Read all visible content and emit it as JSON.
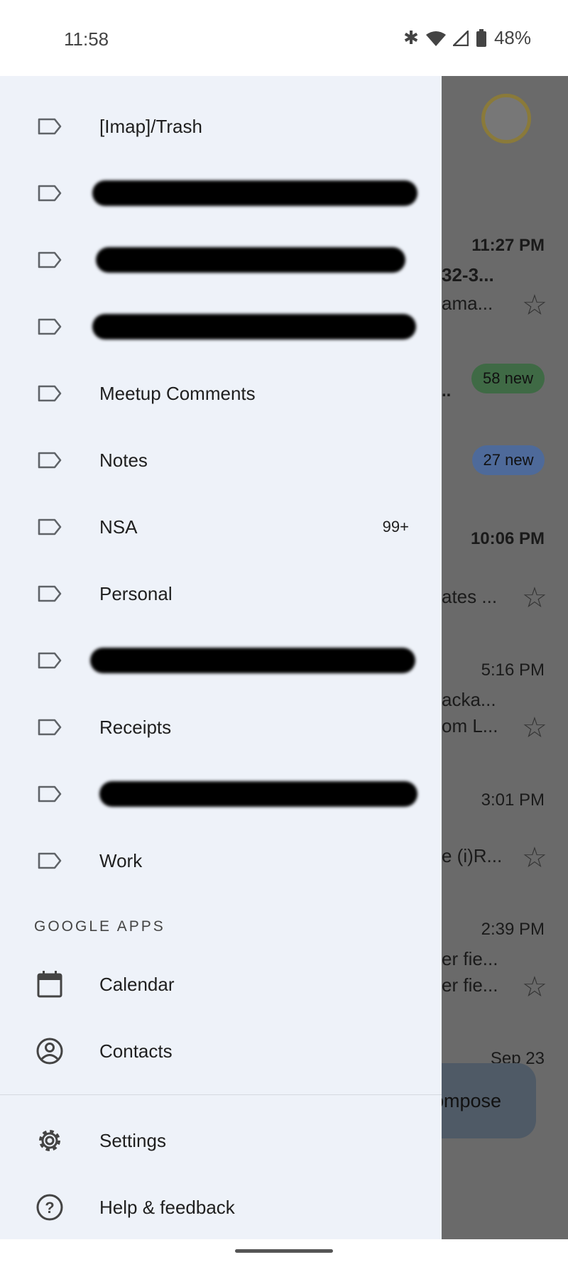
{
  "status_bar": {
    "time": "11:58",
    "battery": "48%",
    "icons": [
      "bluetooth-icon",
      "wifi-icon",
      "signal-icon",
      "battery-icon"
    ]
  },
  "background": {
    "times": [
      "11:27 PM",
      "10:06 PM",
      "5:16 PM",
      "3:01 PM",
      "2:39 PM",
      "Sep 23"
    ],
    "snippets": [
      "32-3...",
      "ama...",
      "..",
      "ates  ...",
      "acka...",
      "om L...",
      "e (i)R...",
      "er fie...",
      "er fie..."
    ],
    "badges": [
      {
        "label": "58 new",
        "color": "#3f6a45"
      },
      {
        "label": "27 new",
        "color": "#4e6a9a"
      }
    ],
    "compose_label": "ompose"
  },
  "drawer": {
    "labels": [
      {
        "label": "[Imap]/Trash",
        "count": ""
      },
      {
        "label": "",
        "redacted": true
      },
      {
        "label": "",
        "redacted": true
      },
      {
        "label": "",
        "redacted": true
      },
      {
        "label": "Meetup Comments",
        "count": ""
      },
      {
        "label": "Notes",
        "count": ""
      },
      {
        "label": "NSA",
        "count": "99+"
      },
      {
        "label": "Personal",
        "count": ""
      },
      {
        "label": "",
        "redacted": true
      },
      {
        "label": "Receipts",
        "count": ""
      },
      {
        "label": "",
        "redacted": true
      },
      {
        "label": "Work",
        "count": ""
      }
    ],
    "google_apps_header": "GOOGLE APPS",
    "apps": [
      {
        "label": "Calendar",
        "icon": "calendar-icon"
      },
      {
        "label": "Contacts",
        "icon": "contacts-icon"
      }
    ],
    "footer": [
      {
        "label": "Settings",
        "icon": "gear-icon"
      },
      {
        "label": "Help & feedback",
        "icon": "help-icon"
      }
    ]
  },
  "colors": {
    "drawer_bg": "#eef2f9",
    "scrim": "#6a6a6a"
  }
}
